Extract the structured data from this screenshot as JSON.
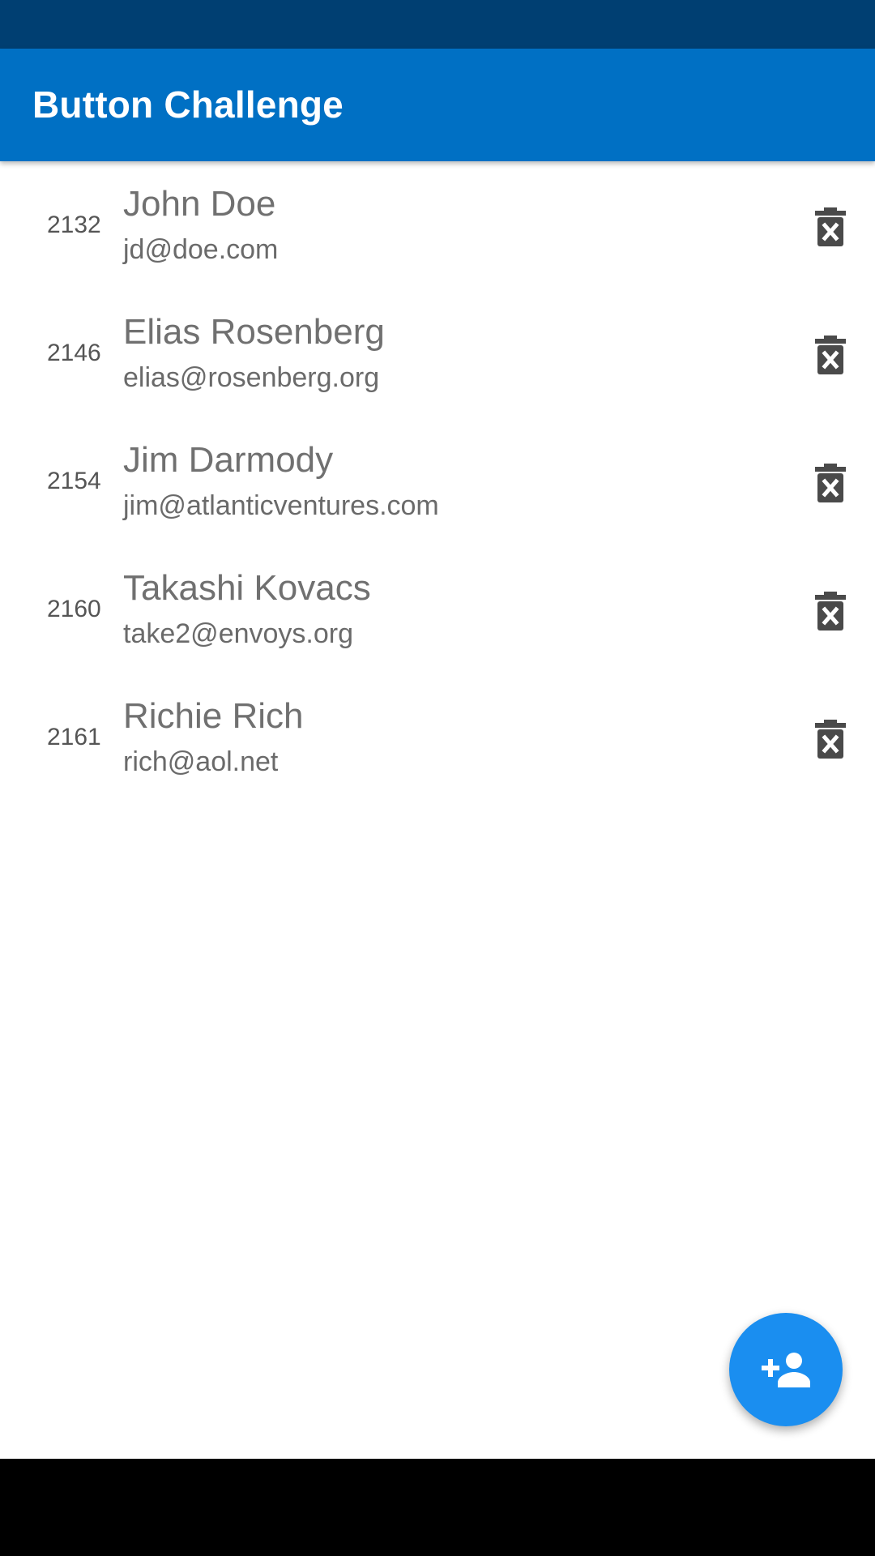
{
  "app": {
    "title": "Button Challenge"
  },
  "colors": {
    "status_bar": "#003f72",
    "app_bar": "#0070c4",
    "fab": "#1a8ef0",
    "delete_icon": "#4a4a4a"
  },
  "contacts": [
    {
      "id": "2132",
      "name": "John Doe",
      "email": "jd@doe.com"
    },
    {
      "id": "2146",
      "name": "Elias Rosenberg",
      "email": "elias@rosenberg.org"
    },
    {
      "id": "2154",
      "name": "Jim Darmody",
      "email": "jim@atlanticventures.com"
    },
    {
      "id": "2160",
      "name": "Takashi Kovacs",
      "email": "take2@envoys.org"
    },
    {
      "id": "2161",
      "name": "Richie Rich",
      "email": "rich@aol.net"
    }
  ],
  "icons": {
    "delete": "delete-forever-icon",
    "fab": "person-add-icon"
  }
}
